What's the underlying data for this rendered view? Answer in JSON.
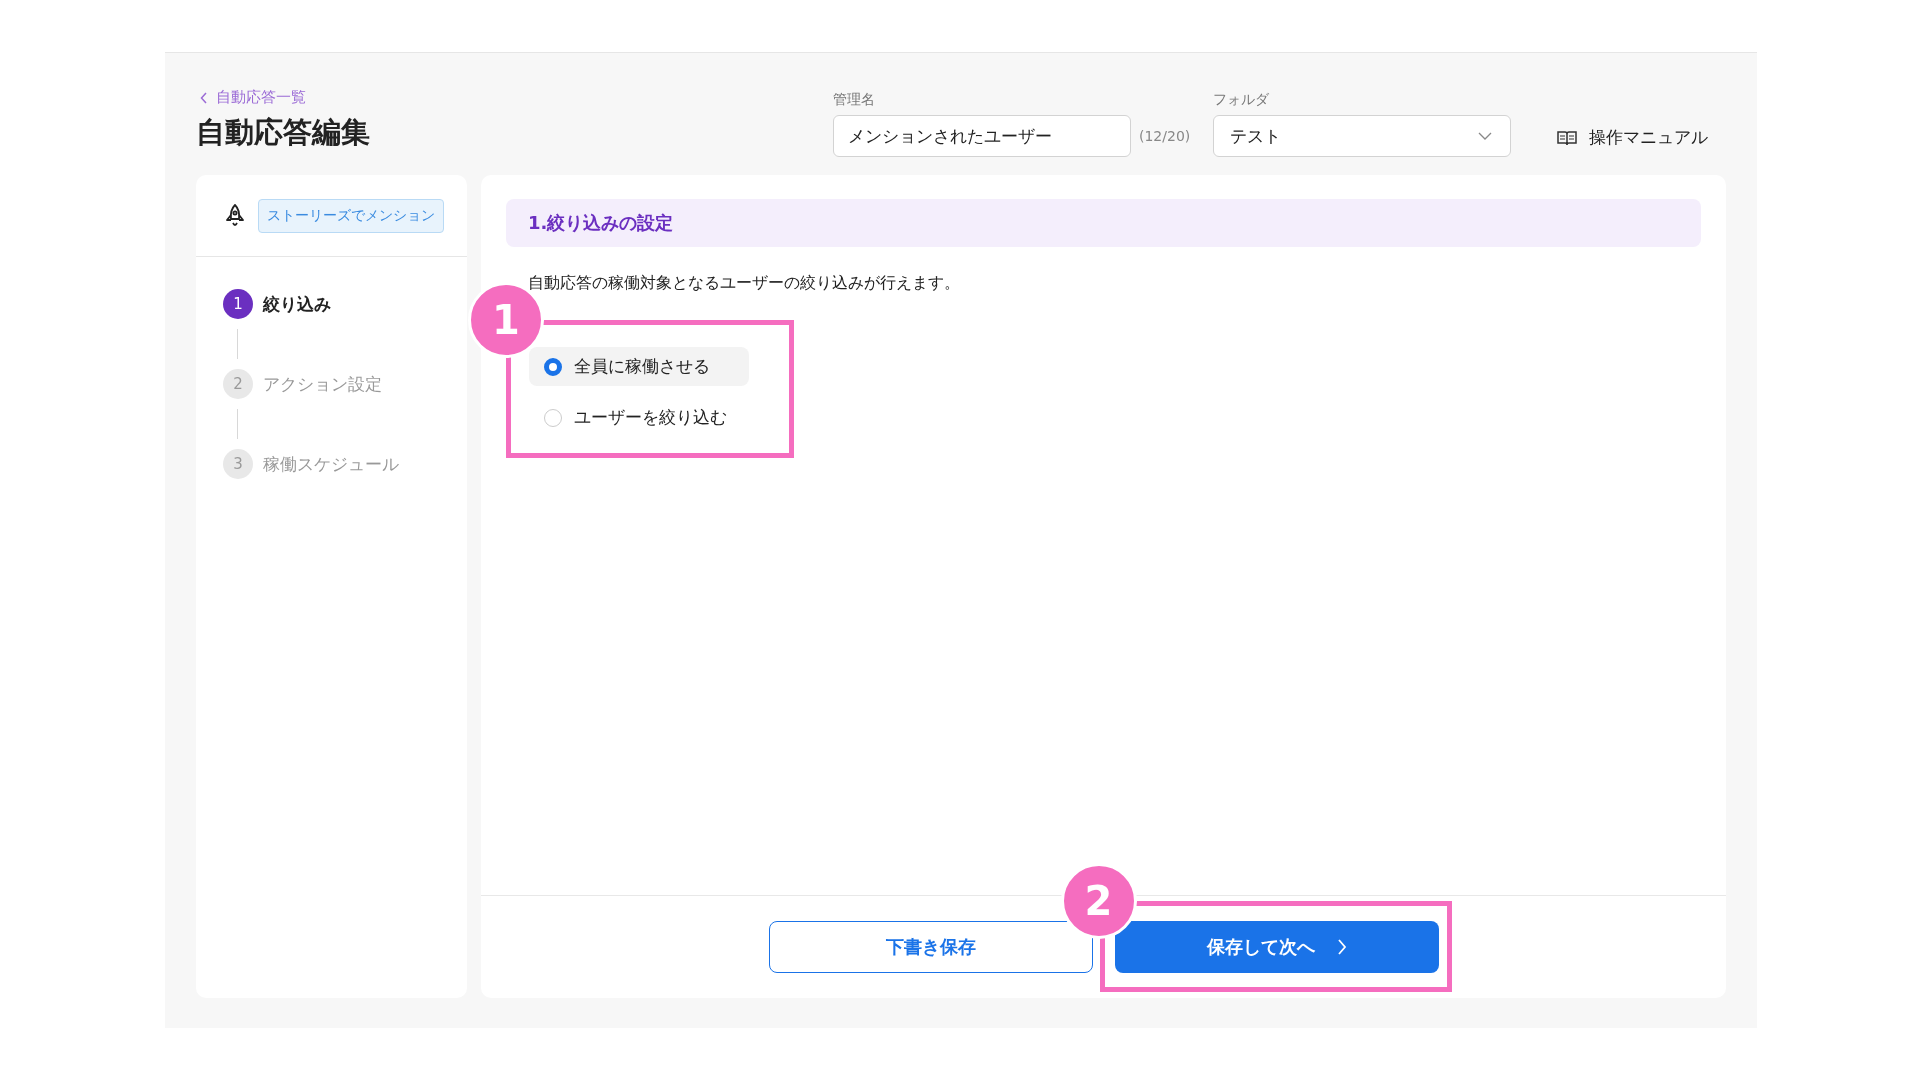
{
  "breadcrumb": {
    "label": "自動応答一覧"
  },
  "title": "自動応答編集",
  "name_field": {
    "label": "管理名",
    "value": "メンションされたユーザー",
    "counter": "(12/20)"
  },
  "folder_field": {
    "label": "フォルダ",
    "value": "テスト"
  },
  "manual_link": {
    "label": "操作マニュアル"
  },
  "trigger": {
    "tag": "ストーリーズでメンション"
  },
  "steps": [
    {
      "number": "1",
      "label": "絞り込み",
      "selected": true
    },
    {
      "number": "2",
      "label": "アクション設定",
      "selected": false
    },
    {
      "number": "3",
      "label": "稼働スケジュール",
      "selected": false
    }
  ],
  "section": {
    "title": "1.絞り込みの設定",
    "description": "自動応答の稼働対象となるユーザーの絞り込みが行えます。",
    "annotation": "1",
    "options": [
      {
        "label": "全員に稼働させる",
        "selected": true
      },
      {
        "label": "ユーザーを絞り込む",
        "selected": false
      }
    ]
  },
  "buttons": [
    {
      "kind": "secondary",
      "label": "下書き保存"
    },
    {
      "kind": "primary",
      "label": "保存して次へ",
      "annotation": "2"
    }
  ]
}
